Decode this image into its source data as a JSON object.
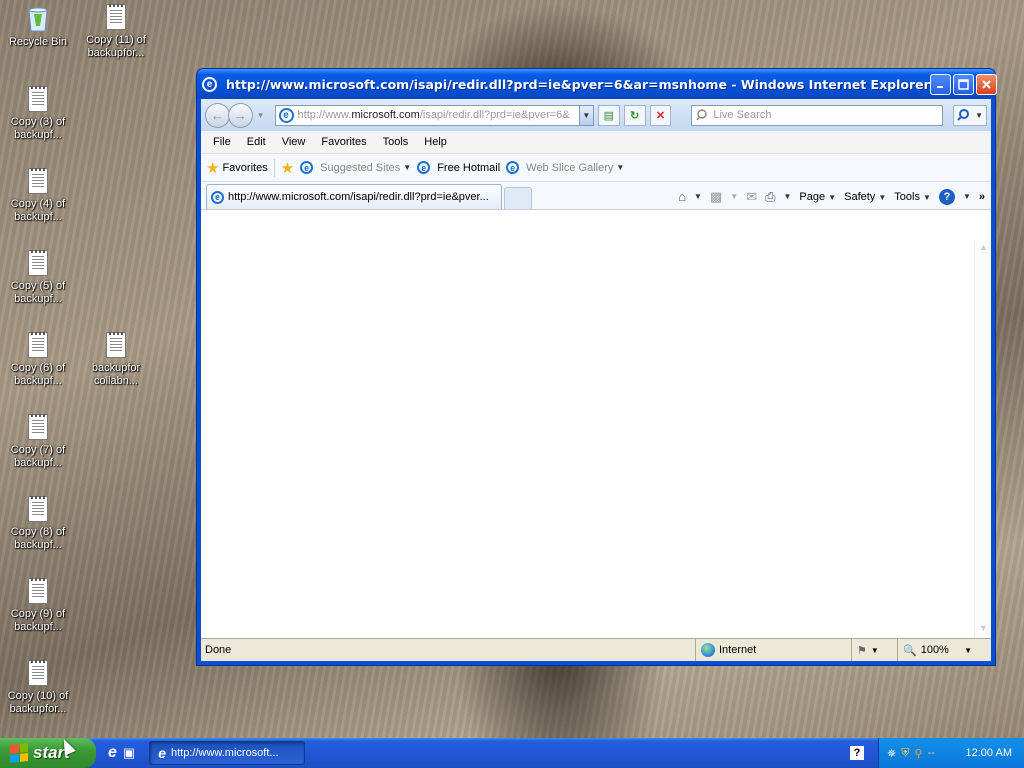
{
  "desktop": {
    "icons": [
      {
        "label": "Recycle Bin"
      },
      {
        "label": "Copy (11) of backupfor..."
      },
      {
        "label": "Copy (3) of backupf..."
      },
      {
        "label": "Copy (4) of backupf..."
      },
      {
        "label": "Copy (5) of backupf..."
      },
      {
        "label": "Copy (6) of backupf..."
      },
      {
        "label": "backupfor collabn..."
      },
      {
        "label": "Copy (7) of backupf..."
      },
      {
        "label": "Copy (8) of backupf..."
      },
      {
        "label": "Copy (9) of backupf..."
      },
      {
        "label": "Copy (10) of backupfor..."
      }
    ]
  },
  "browser": {
    "title": "http://www.microsoft.com/isapi/redir.dll?prd=ie&pver=6&ar=msnhome - Windows Internet Explorer",
    "address": {
      "prefix": "http://www.",
      "domain": "microsoft.com",
      "suffix": "/isapi/redir.dll?prd=ie&pver=6&"
    },
    "search_placeholder": "Live Search",
    "menu": [
      "File",
      "Edit",
      "View",
      "Favorites",
      "Tools",
      "Help"
    ],
    "favorites_bar": {
      "favorites_label": "Favorites",
      "suggested_sites": "Suggested Sites",
      "free_hotmail": "Free Hotmail",
      "web_slice_gallery": "Web Slice Gallery"
    },
    "tab_title": "http://www.microsoft.com/isapi/redir.dll?prd=ie&pver...",
    "command_bar": {
      "page": "Page",
      "safety": "Safety",
      "tools": "Tools"
    },
    "status": {
      "text": "Done",
      "zone": "Internet",
      "zoom": "100%"
    }
  },
  "taskbar": {
    "start_label": "start",
    "task_button": "http://www.microsoft...",
    "help_glyph": "?",
    "clock": "12:00 AM"
  }
}
